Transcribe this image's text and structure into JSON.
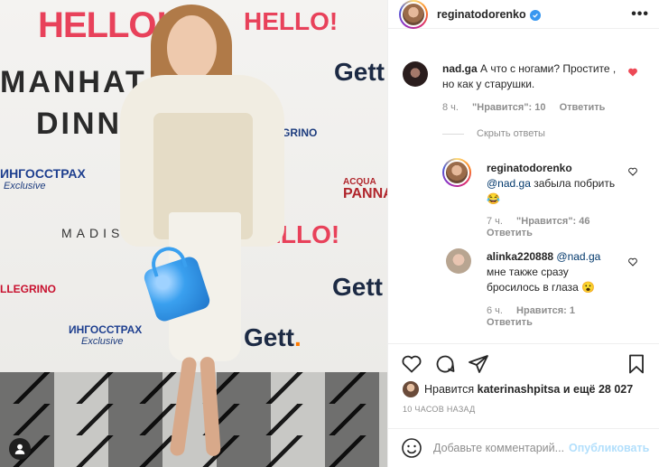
{
  "photo": {
    "sponsors": {
      "hello_top": "HELLO!",
      "hello_top2": "HELLO!",
      "manhattan": "MANHAT",
      "dinner": "DINN",
      "gett_1": "Gett",
      "gett_2": "Gett",
      "gett_3": "Gett",
      "ingos_1": "ИНГОССТРАХ",
      "ingos_1_sub": "Exclusive",
      "ingos_2": "ИНГОССТРАХ",
      "ingos_2_sub": "Exclusive",
      "pellegrino_1": "S.PELLEGRINO",
      "pellegrino_2": "LLEGRINO",
      "madison": "MADISO",
      "panna_top": "ACQUA",
      "panna": "PANNA",
      "hello_mid": "HELLO!",
      "s_fragment": "S."
    },
    "profile_icon": "person-icon"
  },
  "post": {
    "author": "reginatodorenko",
    "verified_icon": "verified-badge-icon",
    "more_icon": "more-icon",
    "more_label": "•••"
  },
  "comments": [
    {
      "username": "nad.ga",
      "text": "А что с ногами? Простите , но как у старушки.",
      "time": "8 ч.",
      "likes": "\"Нравится\": 10",
      "reply": "Ответить",
      "liked": true
    }
  ],
  "hide_replies": "Скрыть ответы",
  "replies": [
    {
      "username": "reginatodorenko",
      "mention": "@nad.ga",
      "text": "забыла побрить 😂",
      "time": "7 ч.",
      "likes": "\"Нравится\": 46",
      "reply": "Ответить"
    },
    {
      "username": "alinka220888",
      "mention": "@nad.ga",
      "text": "мне также сразу бросилось в глаза 😮",
      "time": "6 ч.",
      "likes": "Нравится: 1",
      "reply": "Ответить"
    }
  ],
  "actions": {
    "like_icon": "heart-icon",
    "comment_icon": "comment-icon",
    "share_icon": "send-icon",
    "save_icon": "bookmark-icon"
  },
  "likes": {
    "prefix": "Нравится",
    "user": "katerinashpitsa",
    "suffix": "и ещё 28 027"
  },
  "timestamp": "10 ЧАСОВ НАЗАД",
  "composer": {
    "emoji_icon": "emoji-icon",
    "placeholder": "Добавьте комментарий...",
    "publish": "Опубликовать"
  },
  "colors": {
    "accent_blue": "#3897f0",
    "like_red": "#ed4956",
    "publish_disabled": "#b2dffc",
    "brand_pink": "#e8415a"
  }
}
